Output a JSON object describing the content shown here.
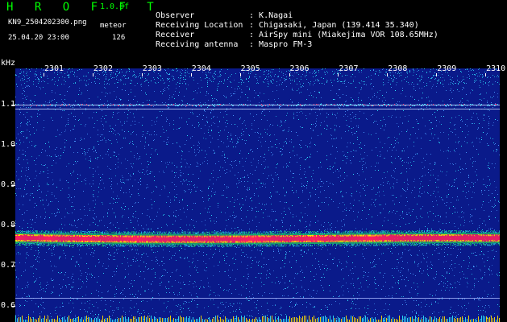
{
  "header": {
    "app_title": "H R O F F T",
    "version": "1.0.0f",
    "filename": "KN9_2504202300.png",
    "meteor_label": "meteor",
    "datetime": "25.04.20 23:00",
    "meteor_count": "126"
  },
  "info": [
    {
      "key": "Observer",
      "value": "K.Nagai"
    },
    {
      "key": "Receiving Location",
      "value": "Chigasaki, Japan (139.414 35.340)"
    },
    {
      "key": "Receiver",
      "value": "AirSpy mini (Miakejima VOR 108.65MHz)"
    },
    {
      "key": "Receiving antenna",
      "value": "Maspro FM-3"
    }
  ],
  "separator": ":",
  "chart_data": {
    "type": "heatmap",
    "ylabel": "kHz",
    "y_ticks": [
      "1.1",
      "1.0",
      "0.9",
      "0.8",
      "0.7",
      "0.6"
    ],
    "x_ticks": [
      "2301",
      "2302",
      "2303",
      "2304",
      "2305",
      "2306",
      "2307",
      "2308",
      "2309",
      "2310"
    ],
    "carrier_band_khz": 0.77,
    "reference_lines_khz": [
      1.1,
      1.09,
      0.62
    ],
    "colors": {
      "background": "#0a1a8a",
      "speckle_light": "#4a9cff",
      "speckle_cyan": "#2ee8ff",
      "band_green": "#20e060",
      "band_red": "#ff2060",
      "band_yellow": "#ffe000"
    }
  }
}
